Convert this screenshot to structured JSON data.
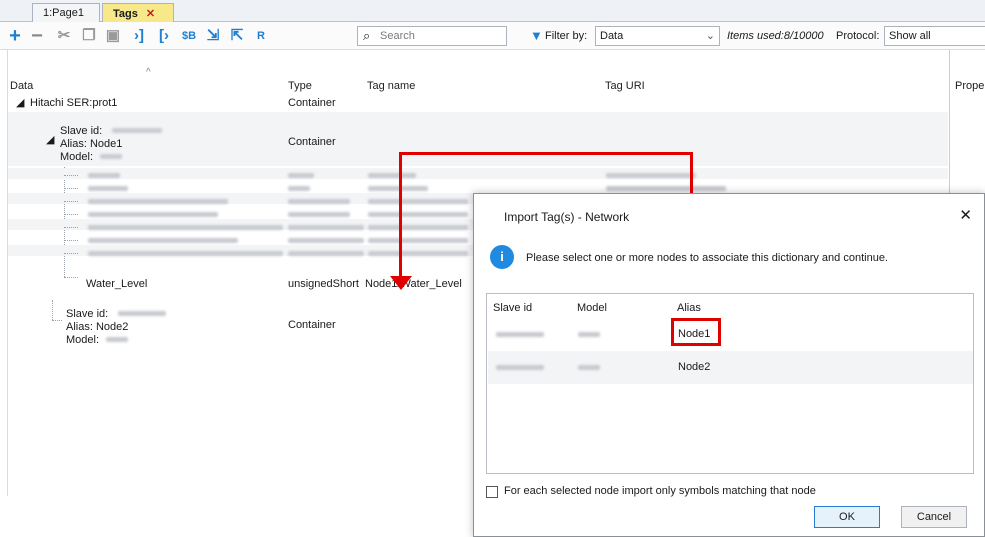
{
  "tabs": [
    {
      "label": "1:Page1"
    },
    {
      "label": "Tags",
      "close": "✕"
    }
  ],
  "toolbar": {
    "icons": [
      "add-icon",
      "remove-icon",
      "cut-icon",
      "copy-icon",
      "paste-icon",
      "go-to-tag-icon",
      "expand-icon",
      "refresh-icon",
      "import-icon",
      "export-icon",
      "r-icon"
    ],
    "search_placeholder": "Search",
    "filter_label": "Filter by:",
    "filter_value": "Data",
    "items_used": "Items used:8/10000",
    "protocol_label": "Protocol:",
    "protocol_value": "Show all"
  },
  "columns": {
    "data": "Data",
    "type": "Type",
    "tag_name": "Tag name",
    "tag_uri": "Tag URI",
    "properties": "Proper"
  },
  "tree": {
    "root": {
      "label": "Hitachi SER:prot1",
      "type": "Container"
    },
    "node1": {
      "slave": "Slave id:",
      "alias": "Alias: Node1",
      "model": "Model:",
      "type": "Container"
    },
    "water": {
      "label": "Water_Level",
      "type": "unsignedShort",
      "tag": "Node1/Water_Level"
    },
    "node2": {
      "slave": "Slave id:",
      "alias": "Alias: Node2",
      "model": "Model:",
      "type": "Container"
    }
  },
  "dialog": {
    "title": "Import Tag(s) - Network",
    "close": "✕",
    "info_icon": "i",
    "message": "Please select one or more nodes to associate this dictionary and continue.",
    "headers": {
      "slave": "Slave id",
      "model": "Model",
      "alias": "Alias"
    },
    "rows": [
      {
        "alias": "Node1"
      },
      {
        "alias": "Node2"
      }
    ],
    "checkbox_label": "For each selected node import only symbols matching that node",
    "ok": "OK",
    "cancel": "Cancel"
  },
  "colors": {
    "highlight": "#e00000",
    "accent": "#1f8ae0"
  }
}
